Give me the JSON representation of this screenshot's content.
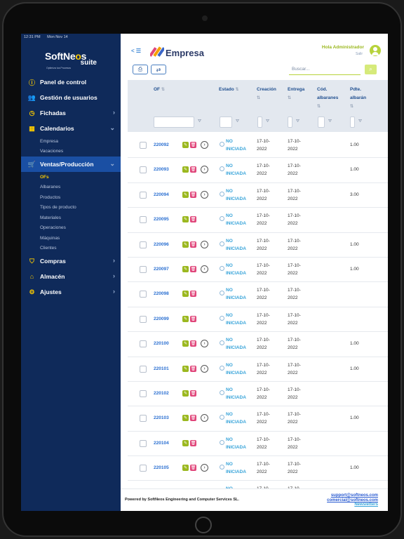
{
  "status_bar": {
    "time": "12:31 PM",
    "date": "Mon Nov 14"
  },
  "logo": {
    "part1": "SoftNe",
    "part_o": "o",
    "part2": "s",
    "suite": "suite",
    "tagline": "Optimiza tus Procesos"
  },
  "sidebar": {
    "items": [
      {
        "label": "Panel de control",
        "icon": "info-icon",
        "chevron": ""
      },
      {
        "label": "Gestión de usuarios",
        "icon": "users-icon",
        "chevron": ""
      },
      {
        "label": "Fichadas",
        "icon": "clock-icon",
        "chevron": "›"
      },
      {
        "label": "Calendarios",
        "icon": "calendar-icon",
        "chevron": "⌄"
      },
      {
        "label": "Ventas/Producción",
        "icon": "cart-icon",
        "chevron": "⌄"
      },
      {
        "label": "Compras",
        "icon": "basket-icon",
        "chevron": "›"
      },
      {
        "label": "Almacén",
        "icon": "warehouse-icon",
        "chevron": "›"
      },
      {
        "label": "Ajustes",
        "icon": "gear-icon",
        "chevron": "›"
      }
    ],
    "calendar_sub": [
      "Empresa",
      "Vacaciones"
    ],
    "ventas_sub": [
      "OFs",
      "Albaranes",
      "Productos",
      "Tipos de producto",
      "Materiales",
      "Operaciones",
      "Máquinas",
      "Clientes"
    ],
    "colors": {
      "bg": "#0f2a5a",
      "active": "#1a4fa3",
      "accent": "#f6c700"
    }
  },
  "header": {
    "back": "< ☰",
    "title": "Empresa",
    "greeting": "Hola Administrador",
    "greeting_sub": "Salir"
  },
  "toolbar": {
    "search_placeholder": "Buscar..."
  },
  "table": {
    "columns": {
      "of": "OF",
      "estado": "Estado",
      "creacion": "Creación",
      "entrega": "Entrega",
      "cod_albaranes_1": "Cód.",
      "cod_albaranes_2": "albaranes",
      "pdte_albaran_1": "Pdte.",
      "pdte_albaran_2": "albarán"
    },
    "rows": [
      {
        "of": "220092",
        "estado1": "NO",
        "estado2": "INICIADA",
        "creacion1": "17-10-",
        "creacion2": "2022",
        "entrega1": "17-10-",
        "entrega2": "2022",
        "pdte": "1.00",
        "go": true
      },
      {
        "of": "220093",
        "estado1": "NO",
        "estado2": "INICIADA",
        "creacion1": "17-10-",
        "creacion2": "2022",
        "entrega1": "17-10-",
        "entrega2": "2022",
        "pdte": "1.00",
        "go": true
      },
      {
        "of": "220094",
        "estado1": "NO",
        "estado2": "INICIADA",
        "creacion1": "17-10-",
        "creacion2": "2022",
        "entrega1": "17-10-",
        "entrega2": "2022",
        "pdte": "3.00",
        "go": true
      },
      {
        "of": "220095",
        "estado1": "NO",
        "estado2": "INICIADA",
        "creacion1": "17-10-",
        "creacion2": "2022",
        "entrega1": "17-10-",
        "entrega2": "2022",
        "pdte": "",
        "go": false
      },
      {
        "of": "220096",
        "estado1": "NO",
        "estado2": "INICIADA",
        "creacion1": "17-10-",
        "creacion2": "2022",
        "entrega1": "17-10-",
        "entrega2": "2022",
        "pdte": "1.00",
        "go": true
      },
      {
        "of": "220097",
        "estado1": "NO",
        "estado2": "INICIADA",
        "creacion1": "17-10-",
        "creacion2": "2022",
        "entrega1": "17-10-",
        "entrega2": "2022",
        "pdte": "1.00",
        "go": true
      },
      {
        "of": "220098",
        "estado1": "NO",
        "estado2": "INICIADA",
        "creacion1": "17-10-",
        "creacion2": "2022",
        "entrega1": "17-10-",
        "entrega2": "2022",
        "pdte": "",
        "go": false
      },
      {
        "of": "220099",
        "estado1": "NO",
        "estado2": "INICIADA",
        "creacion1": "17-10-",
        "creacion2": "2022",
        "entrega1": "17-10-",
        "entrega2": "2022",
        "pdte": "",
        "go": false
      },
      {
        "of": "220100",
        "estado1": "NO",
        "estado2": "INICIADA",
        "creacion1": "17-10-",
        "creacion2": "2022",
        "entrega1": "17-10-",
        "entrega2": "2022",
        "pdte": "1.00",
        "go": true
      },
      {
        "of": "220101",
        "estado1": "NO",
        "estado2": "INICIADA",
        "creacion1": "17-10-",
        "creacion2": "2022",
        "entrega1": "17-10-",
        "entrega2": "2022",
        "pdte": "1.00",
        "go": true
      },
      {
        "of": "220102",
        "estado1": "NO",
        "estado2": "INICIADA",
        "creacion1": "17-10-",
        "creacion2": "2022",
        "entrega1": "17-10-",
        "entrega2": "2022",
        "pdte": "",
        "go": false
      },
      {
        "of": "220103",
        "estado1": "NO",
        "estado2": "INICIADA",
        "creacion1": "17-10-",
        "creacion2": "2022",
        "entrega1": "17-10-",
        "entrega2": "2022",
        "pdte": "1.00",
        "go": true
      },
      {
        "of": "220104",
        "estado1": "NO",
        "estado2": "INICIADA",
        "creacion1": "17-10-",
        "creacion2": "2022",
        "entrega1": "17-10-",
        "entrega2": "2022",
        "pdte": "",
        "go": false
      },
      {
        "of": "220105",
        "estado1": "NO",
        "estado2": "INICIADA",
        "creacion1": "17-10-",
        "creacion2": "2022",
        "entrega1": "17-10-",
        "entrega2": "2022",
        "pdte": "1.00",
        "go": true
      },
      {
        "of": "",
        "estado1": "NO",
        "estado2": "",
        "creacion1": "17-10-",
        "creacion2": "",
        "entrega1": "17-10-",
        "entrega2": "",
        "pdte": "",
        "go": false
      }
    ]
  },
  "footer": {
    "powered": "Powered by SoftNeos Engineering and Computer Services SL.",
    "support": "support@softneos.com",
    "commercial": "comercial@softneos.com",
    "newsletters": "Newsletters"
  }
}
